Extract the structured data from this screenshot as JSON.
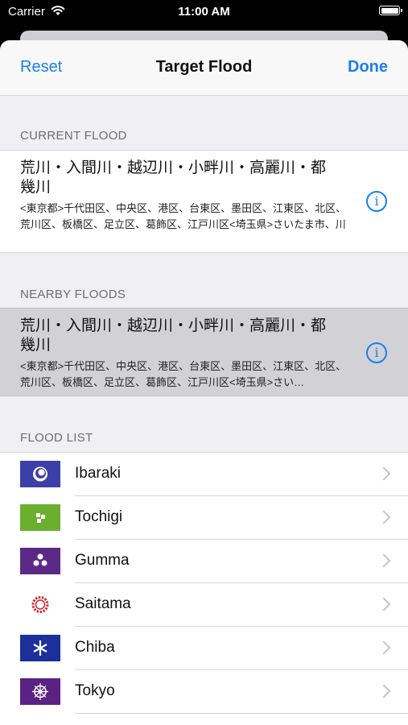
{
  "status_bar": {
    "carrier": "Carrier",
    "time": "11:00 AM"
  },
  "nav": {
    "reset": "Reset",
    "title": "Target Flood",
    "done": "Done"
  },
  "current": {
    "header": "CURRENT FLOOD",
    "title": "荒川・入間川・越辺川・小畔川・高麗川・都幾川",
    "subtitle": "<東京都>千代田区、中央区、港区、台東区、墨田区、江東区、北区、荒川区、板橋区、足立区、葛飾区、江戸川区<埼玉県>さいたま市、川越市、熊谷市、川口市、行田市、加須市、東松山市、春…"
  },
  "nearby": {
    "header": "NEARBY FLOODS",
    "title": "荒川・入間川・越辺川・小畔川・高麗川・都幾川",
    "subtitle": "<東京都>千代田区、中央区、港区、台東区、墨田区、江東区、北区、荒川区、板橋区、足立区、葛飾区、江戸川区<埼玉県>さい…"
  },
  "flood_list": {
    "header": "FLOOD LIST",
    "items": [
      {
        "label": "Ibaraki",
        "flag_color": "#3d3fa8",
        "icon": "ibaraki-emblem-icon"
      },
      {
        "label": "Tochigi",
        "flag_color": "#6cae2e",
        "icon": "tochigi-emblem-icon"
      },
      {
        "label": "Gumma",
        "flag_color": "#5b2a86",
        "icon": "gumma-emblem-icon"
      },
      {
        "label": "Saitama",
        "flag_color": "#ffffff",
        "icon": "saitama-emblem-icon"
      },
      {
        "label": "Chiba",
        "flag_color": "#1d2f9a",
        "icon": "chiba-emblem-icon"
      },
      {
        "label": "Tokyo",
        "flag_color": "#5a2383",
        "icon": "tokyo-emblem-icon"
      },
      {
        "label": "",
        "flag_color": "#ffffff",
        "icon": "partial-emblem-icon"
      }
    ]
  },
  "colors": {
    "accent": "#1a7ff0",
    "background": "#efeff4",
    "selected": "#d1d1d6"
  }
}
